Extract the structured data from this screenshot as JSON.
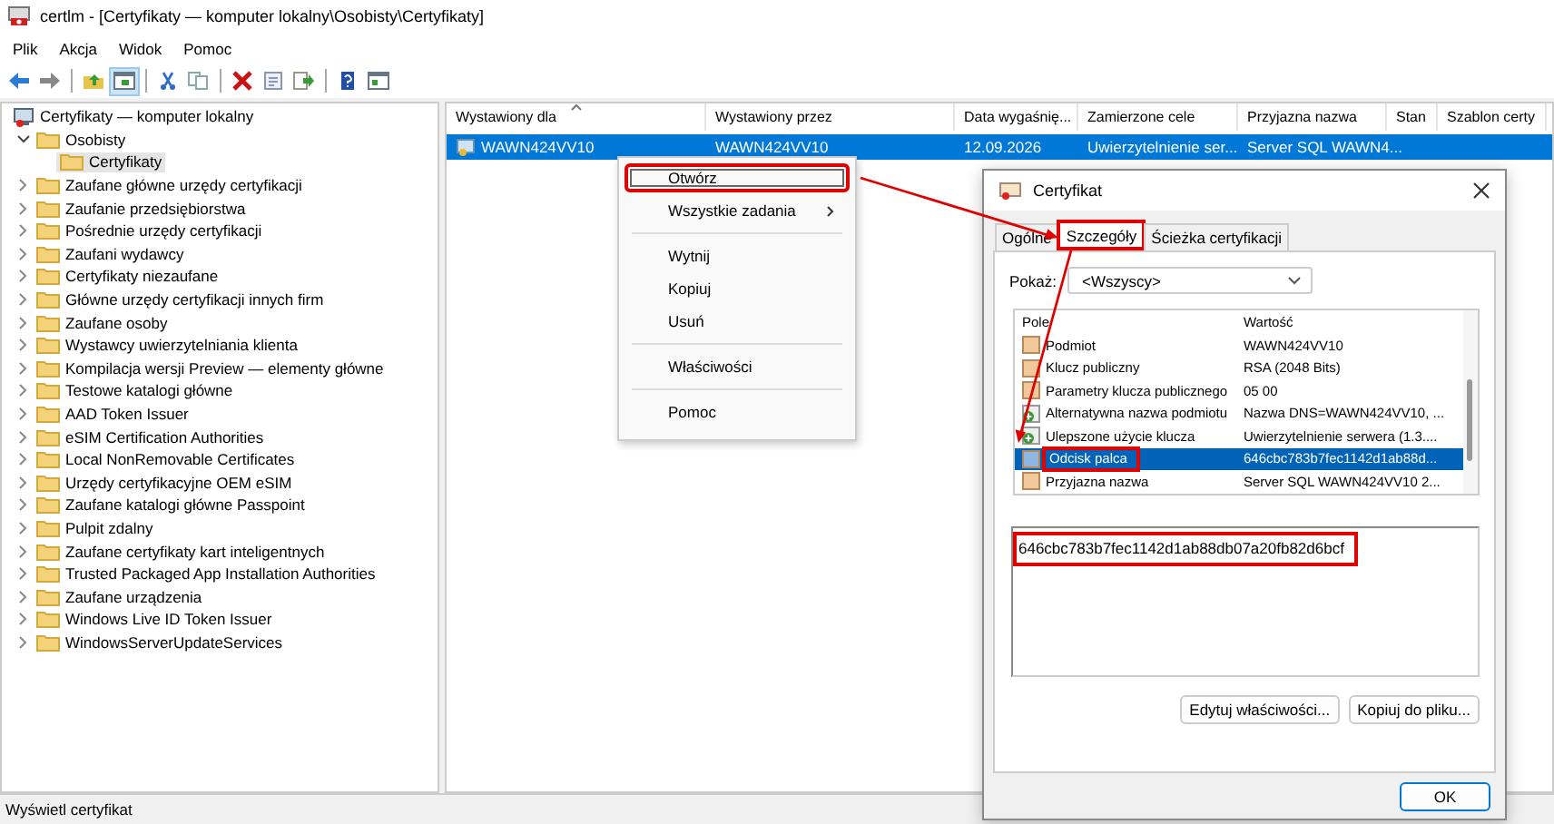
{
  "window": {
    "title": "certlm - [Certyfikaty — komputer lokalny\\Osobisty\\Certyfikaty]"
  },
  "menu": [
    "Plik",
    "Akcja",
    "Widok",
    "Pomoc"
  ],
  "toolbar": [
    {
      "kind": "back",
      "selected": false
    },
    {
      "kind": "forward",
      "selected": false
    },
    {
      "kind": "separator"
    },
    {
      "kind": "up",
      "selected": false
    },
    {
      "kind": "tree",
      "selected": true
    },
    {
      "kind": "separator"
    },
    {
      "kind": "cut",
      "selected": false
    },
    {
      "kind": "copy",
      "selected": false
    },
    {
      "kind": "separator"
    },
    {
      "kind": "delete",
      "selected": false
    },
    {
      "kind": "properties",
      "selected": false
    },
    {
      "kind": "export",
      "selected": false
    },
    {
      "kind": "separator"
    },
    {
      "kind": "help",
      "selected": false
    },
    {
      "kind": "view",
      "selected": false
    }
  ],
  "tree": [
    {
      "label": "Certyfikaty — komputer lokalny",
      "kind": "root",
      "selected": false,
      "children": [
        {
          "label": "Osobisty",
          "kind": "folder",
          "expanded": true,
          "selected": false,
          "children": [
            {
              "label": "Certyfikaty",
              "kind": "folder",
              "selected": true
            }
          ]
        },
        {
          "label": "Zaufane główne urzędy certyfikacji",
          "kind": "folder",
          "expanded": false,
          "selected": false
        },
        {
          "label": "Zaufanie przedsiębiorstwa",
          "kind": "folder",
          "expanded": false,
          "selected": false
        },
        {
          "label": "Pośrednie urzędy certyfikacji",
          "kind": "folder",
          "expanded": false,
          "selected": false
        },
        {
          "label": "Zaufani wydawcy",
          "kind": "folder",
          "expanded": false,
          "selected": false
        },
        {
          "label": "Certyfikaty niezaufane",
          "kind": "folder",
          "expanded": false,
          "selected": false
        },
        {
          "label": "Główne urzędy certyfikacji innych firm",
          "kind": "folder",
          "expanded": false,
          "selected": false
        },
        {
          "label": "Zaufane osoby",
          "kind": "folder",
          "expanded": false,
          "selected": false
        },
        {
          "label": "Wystawcy uwierzytelniania klienta",
          "kind": "folder",
          "expanded": false,
          "selected": false
        },
        {
          "label": "Kompilacja wersji Preview — elementy główne",
          "kind": "folder",
          "expanded": false,
          "selected": false
        },
        {
          "label": "Testowe katalogi główne",
          "kind": "folder",
          "expanded": false,
          "selected": false
        },
        {
          "label": "AAD Token Issuer",
          "kind": "folder",
          "expanded": false,
          "selected": false
        },
        {
          "label": "eSIM Certification Authorities",
          "kind": "folder",
          "expanded": false,
          "selected": false
        },
        {
          "label": "Local NonRemovable Certificates",
          "kind": "folder",
          "expanded": false,
          "selected": false
        },
        {
          "label": "Urzędy certyfikacyjne OEM eSIM",
          "kind": "folder",
          "expanded": false,
          "selected": false
        },
        {
          "label": "Zaufane katalogi główne Passpoint",
          "kind": "folder",
          "expanded": false,
          "selected": false
        },
        {
          "label": "Pulpit zdalny",
          "kind": "folder",
          "expanded": false,
          "selected": false
        },
        {
          "label": "Zaufane certyfikaty kart inteligentnych",
          "kind": "folder",
          "expanded": false,
          "selected": false
        },
        {
          "label": "Trusted Packaged App Installation Authorities",
          "kind": "folder",
          "expanded": false,
          "selected": false
        },
        {
          "label": "Zaufane urządzenia",
          "kind": "folder",
          "expanded": false,
          "selected": false
        },
        {
          "label": "Windows Live ID Token Issuer",
          "kind": "folder",
          "expanded": false,
          "selected": false
        },
        {
          "label": "WindowsServerUpdateServices",
          "kind": "folder",
          "expanded": false,
          "selected": false
        }
      ]
    }
  ],
  "table": {
    "columns": [
      {
        "label": "Wystawiony dla",
        "sorted": true
      },
      {
        "label": "Wystawiony przez",
        "sorted": false
      },
      {
        "label": "Data wygaśnię...",
        "sorted": false
      },
      {
        "label": "Zamierzone cele",
        "sorted": false
      },
      {
        "label": "Przyjazna nazwa",
        "sorted": false
      },
      {
        "label": "Stan",
        "sorted": false
      },
      {
        "label": "Szablon certy",
        "sorted": false
      }
    ],
    "rows": [
      {
        "selected": true,
        "cells": [
          "WAWN424VV10",
          "WAWN424VV10",
          "12.09.2026",
          "Uwierzytelnienie ser...",
          "Server SQL WAWN4..."
        ]
      }
    ]
  },
  "context_menu": {
    "items": [
      {
        "kind": "item",
        "label": "Otwórz",
        "selected": true,
        "highlighted": true,
        "submenu": false
      },
      {
        "kind": "item",
        "label": "Wszystkie zadania",
        "selected": false,
        "highlighted": false,
        "submenu": true
      },
      {
        "kind": "separator"
      },
      {
        "kind": "item",
        "label": "Wytnij",
        "selected": false,
        "highlighted": false,
        "submenu": false
      },
      {
        "kind": "item",
        "label": "Kopiuj",
        "selected": false,
        "highlighted": false,
        "submenu": false
      },
      {
        "kind": "item",
        "label": "Usuń",
        "selected": false,
        "highlighted": false,
        "submenu": false
      },
      {
        "kind": "separator"
      },
      {
        "kind": "item",
        "label": "Właściwości",
        "selected": false,
        "highlighted": false,
        "submenu": false
      },
      {
        "kind": "separator"
      },
      {
        "kind": "item",
        "label": "Pomoc",
        "selected": false,
        "highlighted": false,
        "submenu": false
      }
    ]
  },
  "dialog": {
    "title": "Certyfikat",
    "tabs": [
      {
        "label": "Ogólne",
        "selected": false,
        "highlighted": false
      },
      {
        "label": "Szczegóły",
        "selected": true,
        "highlighted": true
      },
      {
        "label": "Ścieżka certyfikacji",
        "selected": false,
        "highlighted": false
      }
    ],
    "show": {
      "label": "Pokaż:",
      "value": "<Wszyscy>"
    },
    "fields": {
      "columns": [
        "Pole",
        "Wartość"
      ],
      "rows": [
        {
          "kind": "field",
          "name": "Podmiot",
          "value": "WAWN424VV10",
          "selected": false,
          "highlighted": false
        },
        {
          "kind": "field",
          "name": "Klucz publiczny",
          "value": "RSA (2048 Bits)",
          "selected": false,
          "highlighted": false
        },
        {
          "kind": "field",
          "name": "Parametry klucza publicznego",
          "value": "05 00",
          "selected": false,
          "highlighted": false
        },
        {
          "kind": "extension",
          "name": "Alternatywna nazwa podmiotu",
          "value": "Nazwa DNS=WAWN424VV10, ...",
          "selected": false,
          "highlighted": false
        },
        {
          "kind": "extension",
          "name": "Ulepszone użycie klucza",
          "value": "Uwierzytelnienie serwera (1.3....",
          "selected": false,
          "highlighted": false
        },
        {
          "kind": "field",
          "name": "Odcisk palca",
          "value": "646cbc783b7fec1142d1ab88d...",
          "selected": true,
          "highlighted": true
        },
        {
          "kind": "field",
          "name": "Przyjazna nazwa",
          "value": "Server SQL WAWN424VV10 2...",
          "selected": false,
          "highlighted": false
        }
      ]
    },
    "value_box": {
      "text": "646cbc783b7fec1142d1ab88db07a20fb82d6bcf",
      "highlighted": true
    },
    "buttons": [
      "Edytuj właściwości...",
      "Kopiuj do pliku..."
    ],
    "ok": "OK"
  },
  "status_bar": "Wyświetl certyfikat"
}
